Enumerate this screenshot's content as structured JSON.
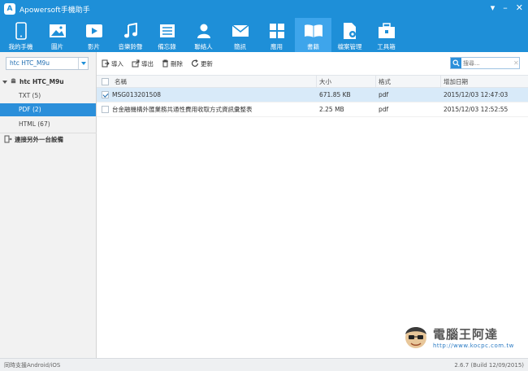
{
  "window": {
    "title": "Apowersoft手機助手",
    "logo_glyph": "A"
  },
  "toolbar": {
    "items": [
      {
        "label": "我的手機",
        "icon": "phone-icon"
      },
      {
        "label": "圖片",
        "icon": "picture-icon"
      },
      {
        "label": "影片",
        "icon": "video-icon"
      },
      {
        "label": "音樂鈴聲",
        "icon": "music-icon"
      },
      {
        "label": "備忘錄",
        "icon": "memo-icon"
      },
      {
        "label": "聯絡人",
        "icon": "contact-icon"
      },
      {
        "label": "簡訊",
        "icon": "message-icon"
      },
      {
        "label": "應用",
        "icon": "apps-icon"
      },
      {
        "label": "書籍",
        "icon": "book-icon",
        "active": true
      },
      {
        "label": "檔案管理",
        "icon": "file-manager-icon"
      },
      {
        "label": "工具箱",
        "icon": "toolbox-icon"
      }
    ]
  },
  "sidebar": {
    "device_select": "htc HTC_M9u",
    "device_name": "htc HTC_M9u",
    "items": [
      {
        "label": "TXT (5)"
      },
      {
        "label": "PDF (2)",
        "selected": true
      },
      {
        "label": "HTML (67)"
      }
    ],
    "connect_label": "連接另外一台設備"
  },
  "actions": {
    "import": "導入",
    "export": "導出",
    "delete": "刪除",
    "refresh": "更新"
  },
  "search": {
    "placeholder": "搜尋..."
  },
  "table": {
    "headers": {
      "name": "名稱",
      "size": "大小",
      "format": "格式",
      "date": "增加日期"
    },
    "rows": [
      {
        "name": "MSG013201508",
        "size": "671.85 KB",
        "format": "pdf",
        "date": "2015/12/03 12:47:03",
        "checked": true
      },
      {
        "name": "台金融機構外匯業務共通性費用收取方式資訊彙整表",
        "size": "2.25 MB",
        "format": "pdf",
        "date": "2015/12/03 12:52:55",
        "checked": false
      }
    ]
  },
  "watermark": {
    "text": "電腦王阿達",
    "url": "http://www.kocpc.com.tw"
  },
  "status": {
    "left": "同時支援Android/iOS",
    "right": "2.6.7 (Build 12/09/2015)"
  },
  "colors": {
    "accent": "#1e8fd8",
    "active_tab": "#3ea5eb",
    "selected_row": "#d8eaf9",
    "sidebar_selected": "#2b8fda"
  }
}
